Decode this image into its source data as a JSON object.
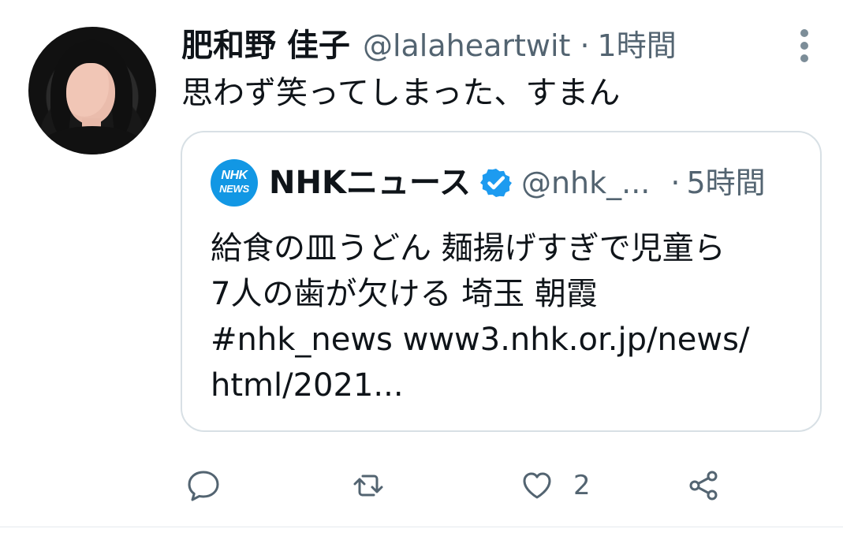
{
  "tweet": {
    "display_name": "肥和野 佳子",
    "handle": "@lalaheartwit",
    "separator": "·",
    "time": "1時間",
    "text": "思わず笑ってしまった、すまん"
  },
  "quoted_tweet": {
    "logo_top": "NHK",
    "logo_bottom": "NEWS",
    "display_name": "NHKニュース",
    "handle": "@nhk_...",
    "separator": "·",
    "time": "5時間",
    "text_lines": [
      "給食の皿うどん 麺揚げすぎで児童ら",
      "7人の歯が欠ける 埼玉 朝霞",
      "#nhk_news www3.nhk.or.jp/news/",
      "html/2021..."
    ]
  },
  "actions": {
    "reply_count": "",
    "retweet_count": "",
    "like_count": "2",
    "share_count": ""
  },
  "icons": {
    "avatar": "profile-photo",
    "more": "more-vertical-icon",
    "verified": "verified-badge-icon",
    "reply": "reply-icon",
    "retweet": "retweet-icon",
    "like": "heart-icon",
    "share": "share-icon"
  },
  "colors": {
    "primary_text": "#0f1419",
    "secondary_text": "#536471",
    "border": "#d8e0e5",
    "nhk_blue": "#1297e4",
    "verified_blue": "#1d9bf0"
  }
}
